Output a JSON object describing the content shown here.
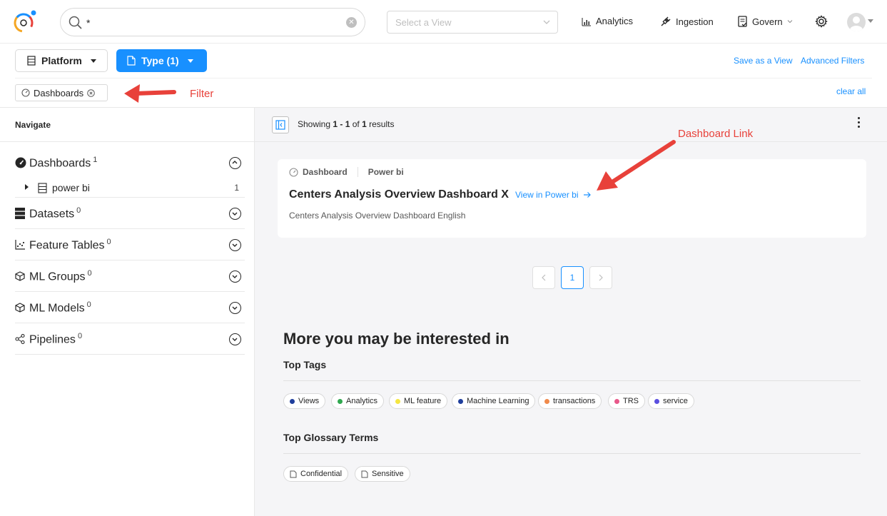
{
  "header": {
    "search_value": "*",
    "view_placeholder": "Select a View",
    "nav": {
      "analytics": "Analytics",
      "ingestion": "Ingestion",
      "govern": "Govern"
    }
  },
  "filters": {
    "platform_label": "Platform",
    "type_label": "Type (1)",
    "save_view": "Save as a View",
    "advanced": "Advanced Filters",
    "active_filter": "Dashboards",
    "clear_all": "clear all"
  },
  "annotations": {
    "filter": "Filter",
    "dashboard_link": "Dashboard Link"
  },
  "sidebar": {
    "heading": "Navigate",
    "items": [
      {
        "label": "Dashboards",
        "count": "1",
        "expanded": true
      },
      {
        "label": "Datasets",
        "count": "0"
      },
      {
        "label": "Feature Tables",
        "count": "0"
      },
      {
        "label": "ML Groups",
        "count": "0"
      },
      {
        "label": "ML Models",
        "count": "0"
      },
      {
        "label": "Pipelines",
        "count": "0"
      }
    ],
    "subitem": {
      "label": "power bi",
      "count": "1"
    }
  },
  "results": {
    "showing_prefix": "Showing ",
    "range": "1 - 1",
    "of": " of ",
    "total": "1",
    "suffix": " results",
    "card": {
      "type": "Dashboard",
      "platform": "Power bi",
      "title": "Centers Analysis Overview Dashboard X",
      "link": "View in Power bi",
      "description": "Centers Analysis Overview Dashboard English"
    },
    "page": "1"
  },
  "more": {
    "title": "More you may be interested in",
    "tags_title": "Top Tags",
    "tags": [
      {
        "label": "Views",
        "color": "#1f3e9c"
      },
      {
        "label": "Analytics",
        "color": "#2fa84f"
      },
      {
        "label": "ML feature",
        "color": "#f5e642"
      },
      {
        "label": "Machine Learning",
        "color": "#1f3e9c"
      },
      {
        "label": "transactions",
        "color": "#f08a4b"
      },
      {
        "label": "TRS",
        "color": "#e8588a"
      },
      {
        "label": "service",
        "color": "#5b4fe0"
      }
    ],
    "glossary_title": "Top Glossary Terms",
    "glossary": [
      "Confidential",
      "Sensitive"
    ]
  }
}
